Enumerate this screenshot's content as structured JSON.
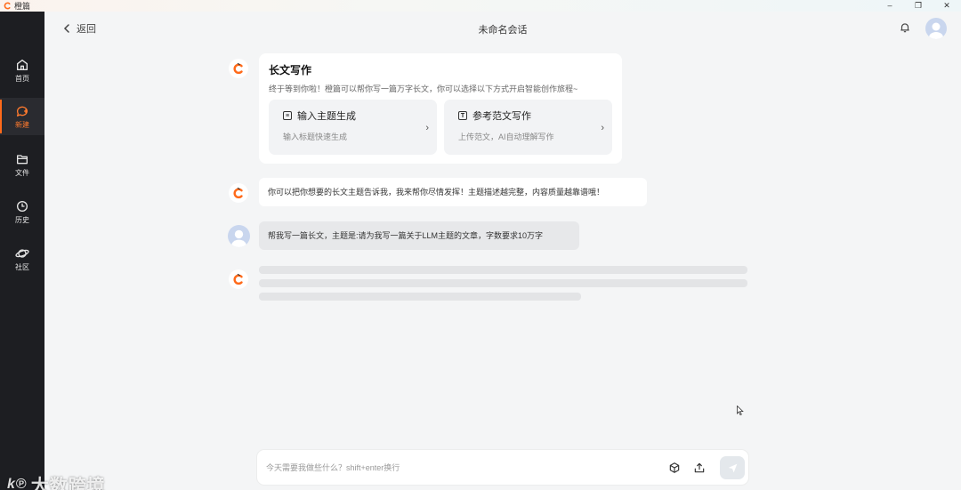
{
  "window": {
    "title": "橙篇",
    "controls": [
      "–",
      "❐",
      "✕"
    ]
  },
  "sidebar": {
    "items": [
      {
        "label": "首页",
        "icon": "home-icon"
      },
      {
        "label": "新建",
        "icon": "new-chat-icon",
        "active": true
      },
      {
        "label": "文件",
        "icon": "folder-icon"
      },
      {
        "label": "历史",
        "icon": "history-icon"
      },
      {
        "label": "社区",
        "icon": "planet-icon"
      }
    ]
  },
  "header": {
    "back_label": "返回",
    "title": "未命名会话"
  },
  "intro_card": {
    "title": "长文写作",
    "description": "终于等到你啦！橙篇可以帮你写一篇万字长文，你可以选择以下方式开启智能创作旅程~",
    "options": [
      {
        "icon_glyph": "≡",
        "title": "输入主题生成",
        "subtitle": "输入标题快速生成"
      },
      {
        "icon_glyph": "T",
        "title": "参考范文写作",
        "subtitle": "上传范文，AI自动理解写作"
      }
    ]
  },
  "messages": [
    {
      "role": "bot",
      "text": "你可以把你想要的长文主题告诉我，我来帮你尽情发挥！主题描述越完整，内容质量越靠谱哦！"
    },
    {
      "role": "user",
      "text": "帮我写一篇长文，主题是:请为我写一篇关于LLM主题的文章，字数要求10万字"
    }
  ],
  "input": {
    "placeholder": "今天需要我做些什么？shift+enter换行",
    "value": ""
  },
  "watermark": {
    "text": "大数跨境"
  },
  "colors": {
    "brand": "#ff6a1a",
    "sidebar_bg": "#1d1e22",
    "page_bg": "#f4f5f6"
  }
}
